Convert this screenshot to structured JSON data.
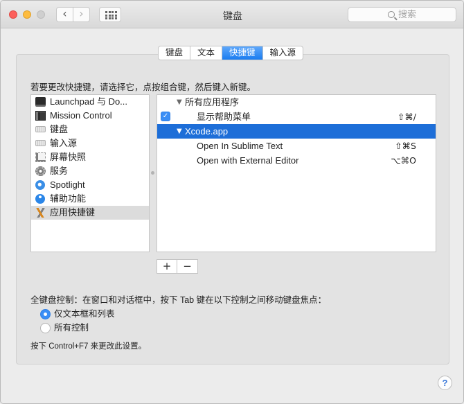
{
  "window": {
    "title": "键盘"
  },
  "toolbar": {
    "back_glyph": "‹",
    "forward_glyph": "›",
    "search_placeholder": "搜索"
  },
  "tabs": [
    {
      "label": "键盘",
      "active": false
    },
    {
      "label": "文本",
      "active": false
    },
    {
      "label": "快捷键",
      "active": true
    },
    {
      "label": "输入源",
      "active": false
    }
  ],
  "instruction": "若要更改快捷键，请选择它，点按组合键，然后键入新键。",
  "categories": [
    {
      "label": "Launchpad 与 Do...",
      "icon": "launchpad-icon",
      "selected": false
    },
    {
      "label": "Mission Control",
      "icon": "mission-control-icon",
      "selected": false
    },
    {
      "label": "键盘",
      "icon": "keyboard-icon",
      "selected": false
    },
    {
      "label": "输入源",
      "icon": "input-source-icon",
      "selected": false
    },
    {
      "label": "屏幕快照",
      "icon": "screenshot-icon",
      "selected": false
    },
    {
      "label": "服务",
      "icon": "services-gear-icon",
      "selected": false
    },
    {
      "label": "Spotlight",
      "icon": "spotlight-icon",
      "selected": false
    },
    {
      "label": "辅助功能",
      "icon": "accessibility-icon",
      "selected": false
    },
    {
      "label": "应用快捷键",
      "icon": "app-shortcuts-icon",
      "selected": true
    }
  ],
  "shortcuts": [
    {
      "label": "所有应用程序",
      "key": "",
      "level": 0,
      "disclosure": "▼",
      "checkbox": false,
      "selected": false
    },
    {
      "label": "显示帮助菜单",
      "key": "⇧⌘/",
      "level": 1,
      "disclosure": "",
      "checkbox": true,
      "selected": false
    },
    {
      "label": "Xcode.app",
      "key": "",
      "level": 0,
      "disclosure": "▼",
      "checkbox": false,
      "selected": true
    },
    {
      "label": "Open In Sublime Text",
      "key": "⇧⌘S",
      "level": 1,
      "disclosure": "",
      "checkbox": false,
      "selected": false
    },
    {
      "label": "Open with External Editor",
      "key": "⌥⌘O",
      "level": 1,
      "disclosure": "",
      "checkbox": false,
      "selected": false
    }
  ],
  "buttons": {
    "add": "+",
    "remove": "−"
  },
  "full_keyboard_access": {
    "label": "全键盘控制：在窗口和对话框中，按下 Tab 键在以下控制之间移动键盘焦点：",
    "options": [
      {
        "label": "仅文本框和列表",
        "selected": true
      },
      {
        "label": "所有控制",
        "selected": false
      }
    ],
    "note": "按下 Control+F7 来更改此设置。"
  },
  "help": {
    "label": "?"
  }
}
